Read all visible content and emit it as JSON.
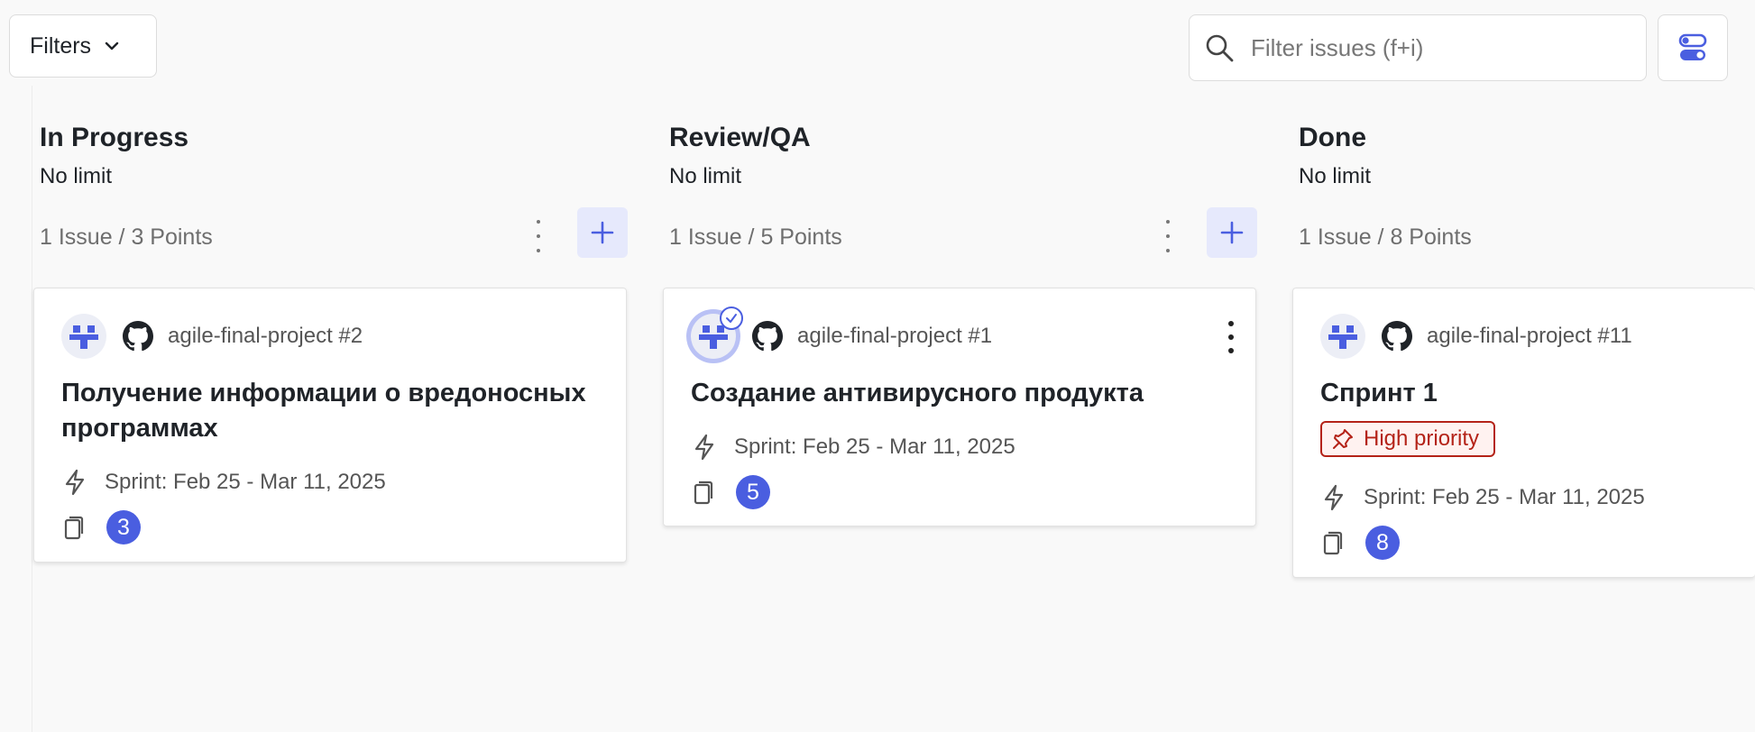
{
  "toolbar": {
    "filters_label": "Filters",
    "search_placeholder": "Filter issues (f+i)"
  },
  "columns": [
    {
      "title": "In Progress",
      "limit": "No limit",
      "stats": "1 Issue / 3 Points",
      "card": {
        "ref": "agile-final-project #2",
        "title": "Получение информации о вредоносных программах",
        "sprint": "Sprint: Feb 25 - Mar 11, 2025",
        "points": "3"
      }
    },
    {
      "title": "Review/QA",
      "limit": "No limit",
      "stats": "1 Issue / 5 Points",
      "card": {
        "ref": "agile-final-project #1",
        "title": "Создание антивирусного продукта",
        "sprint": "Sprint: Feb 25 - Mar 11, 2025",
        "points": "5"
      }
    },
    {
      "title": "Done",
      "limit": "No limit",
      "stats": "1 Issue / 8 Points",
      "card": {
        "ref": "agile-final-project #11",
        "title": "Спринт 1",
        "label": "High priority",
        "sprint": "Sprint: Feb 25 - Mar 11, 2025",
        "points": "8"
      }
    }
  ],
  "colors": {
    "accent": "#4a5ee0",
    "accent_soft": "#e6e9fc",
    "priority": "#b42318",
    "background": "#f9f9f9"
  }
}
